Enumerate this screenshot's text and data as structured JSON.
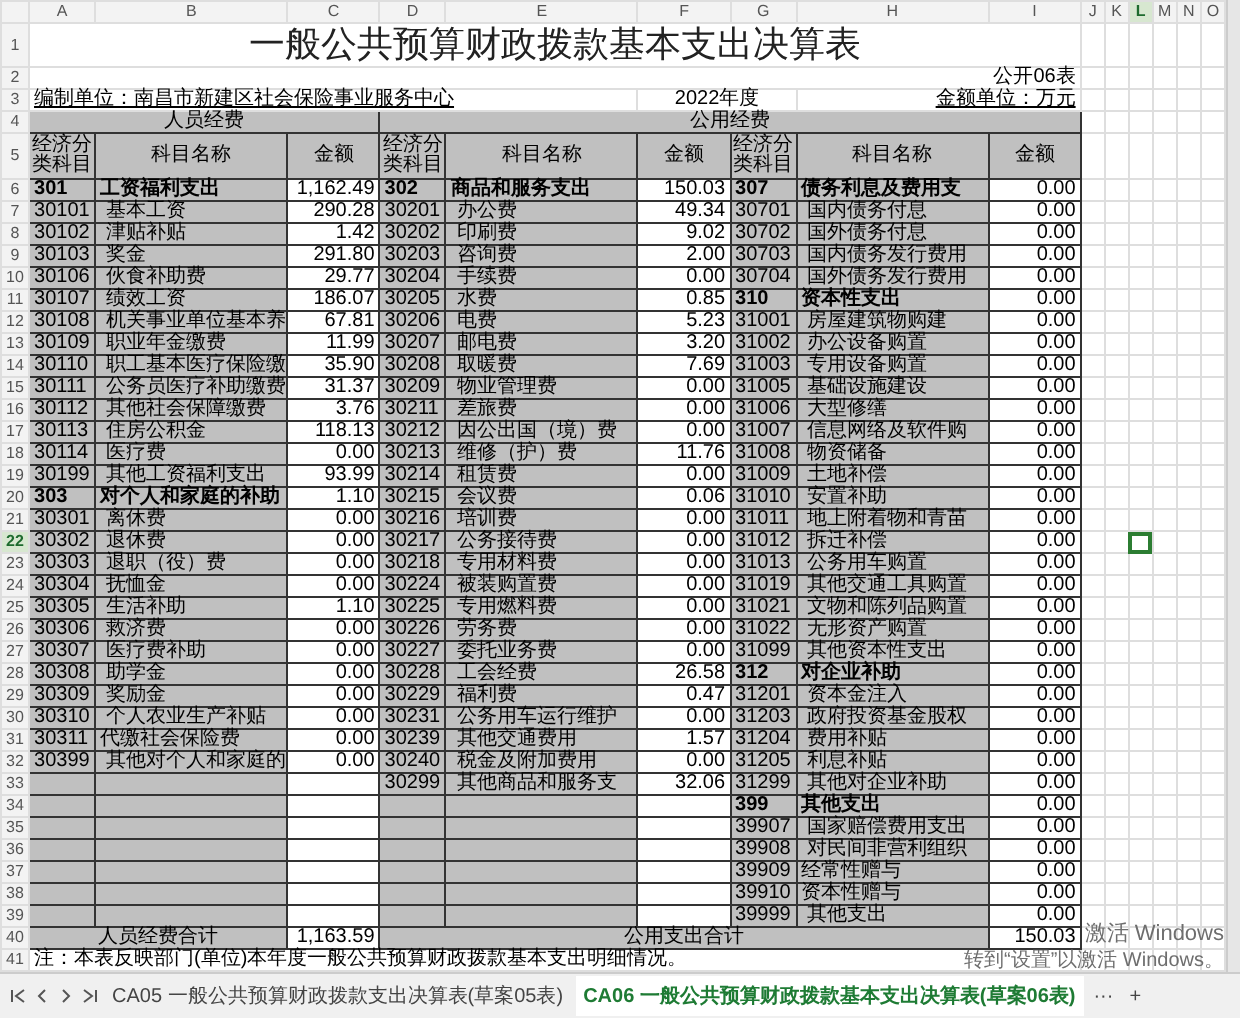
{
  "column_headers": [
    {
      "letter": "A",
      "selected": false
    },
    {
      "letter": "B",
      "selected": false
    },
    {
      "letter": "C",
      "selected": false
    },
    {
      "letter": "D",
      "selected": false
    },
    {
      "letter": "E",
      "selected": false
    },
    {
      "letter": "F",
      "selected": false
    },
    {
      "letter": "G",
      "selected": false
    },
    {
      "letter": "H",
      "selected": false
    },
    {
      "letter": "I",
      "selected": false
    },
    {
      "letter": "J",
      "selected": false
    },
    {
      "letter": "K",
      "selected": false
    },
    {
      "letter": "L",
      "selected": true
    },
    {
      "letter": "M",
      "selected": false
    },
    {
      "letter": "N",
      "selected": false
    },
    {
      "letter": "O",
      "selected": false
    }
  ],
  "row_headers": [
    {
      "label": "1",
      "selected": false
    },
    {
      "label": "2",
      "selected": false
    },
    {
      "label": "3",
      "selected": false
    },
    {
      "label": "4",
      "selected": false
    },
    {
      "label": "5",
      "selected": false
    },
    {
      "label": "6",
      "selected": false
    },
    {
      "label": "7",
      "selected": false
    },
    {
      "label": "8",
      "selected": false
    },
    {
      "label": "9",
      "selected": false
    },
    {
      "label": "10",
      "selected": false
    },
    {
      "label": "11",
      "selected": false
    },
    {
      "label": "12",
      "selected": false
    },
    {
      "label": "13",
      "selected": false
    },
    {
      "label": "14",
      "selected": false
    },
    {
      "label": "15",
      "selected": false
    },
    {
      "label": "16",
      "selected": false
    },
    {
      "label": "17",
      "selected": false
    },
    {
      "label": "18",
      "selected": false
    },
    {
      "label": "19",
      "selected": false
    },
    {
      "label": "20",
      "selected": false
    },
    {
      "label": "21",
      "selected": false
    },
    {
      "label": "22",
      "selected": true
    },
    {
      "label": "23",
      "selected": false
    },
    {
      "label": "24",
      "selected": false
    },
    {
      "label": "25",
      "selected": false
    },
    {
      "label": "26",
      "selected": false
    },
    {
      "label": "27",
      "selected": false
    },
    {
      "label": "28",
      "selected": false
    },
    {
      "label": "29",
      "selected": false
    },
    {
      "label": "30",
      "selected": false
    },
    {
      "label": "31",
      "selected": false
    },
    {
      "label": "32",
      "selected": false
    },
    {
      "label": "33",
      "selected": false
    },
    {
      "label": "34",
      "selected": false
    },
    {
      "label": "35",
      "selected": false
    },
    {
      "label": "36",
      "selected": false
    },
    {
      "label": "37",
      "selected": false
    },
    {
      "label": "38",
      "selected": false
    },
    {
      "label": "39",
      "selected": false
    },
    {
      "label": "40",
      "selected": false
    },
    {
      "label": "41",
      "selected": false
    }
  ],
  "report": {
    "title": "一般公共预算财政拨款基本支出决算表",
    "table_no": "公开06表",
    "unit": "编制单位：南昌市新建区社会保险事业服务中心",
    "year": "2022年度",
    "money_unit": "金额单位：万元",
    "section_left": "人员经费",
    "section_right": "公用经费",
    "headings": [
      "经济分类科目",
      "科目名称",
      "金额",
      "经济分类科目",
      "科目名称",
      "金额",
      "经济分类科目",
      "科目名称",
      "金额"
    ],
    "body": [
      {
        "groups": [
          {
            "kind": "category",
            "code": "301",
            "name": "工资福利支出",
            "amount": "1,162.49"
          },
          {
            "kind": "category",
            "code": "302",
            "name": "商品和服务支出",
            "amount": "150.03"
          },
          {
            "kind": "category",
            "code": "307",
            "name": "债务利息及费用支",
            "amount": "0.00"
          }
        ]
      },
      {
        "groups": [
          {
            "kind": "item",
            "code": "30101",
            "name": "基本工资",
            "amount": "290.28"
          },
          {
            "kind": "item",
            "code": "30201",
            "name": "办公费",
            "amount": "49.34"
          },
          {
            "kind": "item",
            "code": "30701",
            "name": "国内债务付息",
            "amount": "0.00"
          }
        ]
      },
      {
        "groups": [
          {
            "kind": "item",
            "code": "30102",
            "name": "津贴补贴",
            "amount": "1.42"
          },
          {
            "kind": "item",
            "code": "30202",
            "name": "印刷费",
            "amount": "9.02"
          },
          {
            "kind": "item",
            "code": "30702",
            "name": "国外债务付息",
            "amount": "0.00"
          }
        ]
      },
      {
        "groups": [
          {
            "kind": "item",
            "code": "30103",
            "name": "奖金",
            "amount": "291.80"
          },
          {
            "kind": "item",
            "code": "30203",
            "name": "咨询费",
            "amount": "2.00"
          },
          {
            "kind": "item",
            "code": "30703",
            "name": "国内债务发行费用",
            "amount": "0.00"
          }
        ]
      },
      {
        "groups": [
          {
            "kind": "item",
            "code": "30106",
            "name": "伙食补助费",
            "amount": "29.77"
          },
          {
            "kind": "item",
            "code": "30204",
            "name": "手续费",
            "amount": "0.00"
          },
          {
            "kind": "item",
            "code": "30704",
            "name": "国外债务发行费用",
            "amount": "0.00"
          }
        ]
      },
      {
        "groups": [
          {
            "kind": "item",
            "code": "30107",
            "name": "绩效工资",
            "amount": "186.07"
          },
          {
            "kind": "item",
            "code": "30205",
            "name": "水费",
            "amount": "0.85"
          },
          {
            "kind": "category",
            "code": "310",
            "name": "资本性支出",
            "amount": "0.00"
          }
        ]
      },
      {
        "groups": [
          {
            "kind": "item",
            "code": "30108",
            "name": "机关事业单位基本养",
            "amount": "67.81"
          },
          {
            "kind": "item",
            "code": "30206",
            "name": "电费",
            "amount": "5.23"
          },
          {
            "kind": "item",
            "code": "31001",
            "name": "房屋建筑物购建",
            "amount": "0.00"
          }
        ]
      },
      {
        "groups": [
          {
            "kind": "item",
            "code": "30109",
            "name": "职业年金缴费",
            "amount": "11.99"
          },
          {
            "kind": "item",
            "code": "30207",
            "name": "邮电费",
            "amount": "3.20"
          },
          {
            "kind": "item",
            "code": "31002",
            "name": "办公设备购置",
            "amount": "0.00"
          }
        ]
      },
      {
        "groups": [
          {
            "kind": "item",
            "code": "30110",
            "name": "职工基本医疗保险缴",
            "amount": "35.90"
          },
          {
            "kind": "item",
            "code": "30208",
            "name": "取暖费",
            "amount": "7.69"
          },
          {
            "kind": "item",
            "code": "31003",
            "name": "专用设备购置",
            "amount": "0.00"
          }
        ]
      },
      {
        "groups": [
          {
            "kind": "item",
            "code": "30111",
            "name": "公务员医疗补助缴费",
            "amount": "31.37"
          },
          {
            "kind": "item",
            "code": "30209",
            "name": "物业管理费",
            "amount": "0.00"
          },
          {
            "kind": "item",
            "code": "31005",
            "name": "基础设施建设",
            "amount": "0.00"
          }
        ]
      },
      {
        "groups": [
          {
            "kind": "item",
            "code": "30112",
            "name": "其他社会保障缴费",
            "amount": "3.76"
          },
          {
            "kind": "item",
            "code": "30211",
            "name": "差旅费",
            "amount": "0.00"
          },
          {
            "kind": "item",
            "code": "31006",
            "name": "大型修缮",
            "amount": "0.00"
          }
        ]
      },
      {
        "groups": [
          {
            "kind": "item",
            "code": "30113",
            "name": "住房公积金",
            "amount": "118.13"
          },
          {
            "kind": "item",
            "code": "30212",
            "name": "因公出国（境）费",
            "amount": "0.00"
          },
          {
            "kind": "item",
            "code": "31007",
            "name": "信息网络及软件购",
            "amount": "0.00"
          }
        ]
      },
      {
        "groups": [
          {
            "kind": "item",
            "code": "30114",
            "name": "医疗费",
            "amount": "0.00"
          },
          {
            "kind": "item",
            "code": "30213",
            "name": "维修（护）费",
            "amount": "11.76"
          },
          {
            "kind": "item",
            "code": "31008",
            "name": "物资储备",
            "amount": "0.00"
          }
        ]
      },
      {
        "groups": [
          {
            "kind": "item",
            "code": "30199",
            "name": "其他工资福利支出",
            "amount": "93.99"
          },
          {
            "kind": "item",
            "code": "30214",
            "name": "租赁费",
            "amount": "0.00"
          },
          {
            "kind": "item",
            "code": "31009",
            "name": "土地补偿",
            "amount": "0.00"
          }
        ]
      },
      {
        "groups": [
          {
            "kind": "category",
            "code": "303",
            "name": "对个人和家庭的补助",
            "amount": "1.10"
          },
          {
            "kind": "item",
            "code": "30215",
            "name": "会议费",
            "amount": "0.06"
          },
          {
            "kind": "item",
            "code": "31010",
            "name": "安置补助",
            "amount": "0.00"
          }
        ]
      },
      {
        "groups": [
          {
            "kind": "item",
            "code": "30301",
            "name": "离休费",
            "amount": "0.00"
          },
          {
            "kind": "item",
            "code": "30216",
            "name": "培训费",
            "amount": "0.00"
          },
          {
            "kind": "item",
            "code": "31011",
            "name": "地上附着物和青苗",
            "amount": "0.00"
          }
        ]
      },
      {
        "groups": [
          {
            "kind": "item",
            "code": "30302",
            "name": "退休费",
            "amount": "0.00"
          },
          {
            "kind": "item",
            "code": "30217",
            "name": "公务接待费",
            "amount": "0.00"
          },
          {
            "kind": "item",
            "code": "31012",
            "name": "拆迁补偿",
            "amount": "0.00"
          }
        ]
      },
      {
        "groups": [
          {
            "kind": "item",
            "code": "30303",
            "name": "退职（役）费",
            "amount": "0.00"
          },
          {
            "kind": "item",
            "code": "30218",
            "name": "专用材料费",
            "amount": "0.00"
          },
          {
            "kind": "item",
            "code": "31013",
            "name": "公务用车购置",
            "amount": "0.00"
          }
        ]
      },
      {
        "groups": [
          {
            "kind": "item",
            "code": "30304",
            "name": "抚恤金",
            "amount": "0.00"
          },
          {
            "kind": "item",
            "code": "30224",
            "name": "被装购置费",
            "amount": "0.00"
          },
          {
            "kind": "item",
            "code": "31019",
            "name": "其他交通工具购置",
            "amount": "0.00"
          }
        ]
      },
      {
        "groups": [
          {
            "kind": "item",
            "code": "30305",
            "name": "生活补助",
            "amount": "1.10"
          },
          {
            "kind": "item",
            "code": "30225",
            "name": "专用燃料费",
            "amount": "0.00"
          },
          {
            "kind": "item",
            "code": "31021",
            "name": "文物和陈列品购置",
            "amount": "0.00"
          }
        ]
      },
      {
        "groups": [
          {
            "kind": "item",
            "code": "30306",
            "name": "救济费",
            "amount": "0.00"
          },
          {
            "kind": "item",
            "code": "30226",
            "name": "劳务费",
            "amount": "0.00"
          },
          {
            "kind": "item",
            "code": "31022",
            "name": "无形资产购置",
            "amount": "0.00"
          }
        ]
      },
      {
        "groups": [
          {
            "kind": "item",
            "code": "30307",
            "name": "医疗费补助",
            "amount": "0.00"
          },
          {
            "kind": "item",
            "code": "30227",
            "name": "委托业务费",
            "amount": "0.00"
          },
          {
            "kind": "item",
            "code": "31099",
            "name": "其他资本性支出",
            "amount": "0.00"
          }
        ]
      },
      {
        "groups": [
          {
            "kind": "item",
            "code": "30308",
            "name": "助学金",
            "amount": "0.00"
          },
          {
            "kind": "item",
            "code": "30228",
            "name": "工会经费",
            "amount": "26.58"
          },
          {
            "kind": "category",
            "code": "312",
            "name": "对企业补助",
            "amount": "0.00"
          }
        ]
      },
      {
        "groups": [
          {
            "kind": "item",
            "code": "30309",
            "name": "奖励金",
            "amount": "0.00"
          },
          {
            "kind": "item",
            "code": "30229",
            "name": "福利费",
            "amount": "0.47"
          },
          {
            "kind": "item",
            "code": "31201",
            "name": "资本金注入",
            "amount": "0.00"
          }
        ]
      },
      {
        "groups": [
          {
            "kind": "item",
            "code": "30310",
            "name": "个人农业生产补贴",
            "amount": "0.00"
          },
          {
            "kind": "item",
            "code": "30231",
            "name": "公务用车运行维护",
            "amount": "0.00"
          },
          {
            "kind": "item",
            "code": "31203",
            "name": "政府投资基金股权",
            "amount": "0.00"
          }
        ]
      },
      {
        "groups": [
          {
            "kind": "plain",
            "code": "30311",
            "name": "代缴社会保险费",
            "amount": "0.00"
          },
          {
            "kind": "item",
            "code": "30239",
            "name": "其他交通费用",
            "amount": "1.57"
          },
          {
            "kind": "item",
            "code": "31204",
            "name": "费用补贴",
            "amount": "0.00"
          }
        ]
      },
      {
        "groups": [
          {
            "kind": "item",
            "code": "30399",
            "name": "其他对个人和家庭的",
            "amount": "0.00"
          },
          {
            "kind": "item",
            "code": "30240",
            "name": "税金及附加费用",
            "amount": "0.00"
          },
          {
            "kind": "item",
            "code": "31205",
            "name": "利息补贴",
            "amount": "0.00"
          }
        ]
      },
      {
        "groups": [
          {
            "kind": "blank"
          },
          {
            "kind": "item",
            "code": "30299",
            "name": "其他商品和服务支",
            "amount": "32.06"
          },
          {
            "kind": "item",
            "code": "31299",
            "name": "其他对企业补助",
            "amount": "0.00"
          }
        ]
      },
      {
        "groups": [
          {
            "kind": "blank"
          },
          {
            "kind": "blank"
          },
          {
            "kind": "category",
            "code": "399",
            "name": "其他支出",
            "amount": "0.00"
          }
        ]
      },
      {
        "groups": [
          {
            "kind": "blank"
          },
          {
            "kind": "blank"
          },
          {
            "kind": "item",
            "code": "39907",
            "name": "国家赔偿费用支出",
            "amount": "0.00"
          }
        ]
      },
      {
        "groups": [
          {
            "kind": "blank"
          },
          {
            "kind": "blank"
          },
          {
            "kind": "item",
            "code": "39908",
            "name": "对民间非营利组织",
            "amount": "0.00"
          }
        ]
      },
      {
        "groups": [
          {
            "kind": "blank"
          },
          {
            "kind": "blank"
          },
          {
            "kind": "plain",
            "code": "39909",
            "name": "经常性赠与",
            "amount": "0.00"
          }
        ]
      },
      {
        "groups": [
          {
            "kind": "blank"
          },
          {
            "kind": "blank"
          },
          {
            "kind": "plain",
            "code": "39910",
            "name": "资本性赠与",
            "amount": "0.00"
          }
        ]
      },
      {
        "groups": [
          {
            "kind": "blank"
          },
          {
            "kind": "blank"
          },
          {
            "kind": "item",
            "code": "39999",
            "name": "其他支出",
            "amount": "0.00"
          }
        ]
      }
    ],
    "totals": {
      "left_label": "人员经费合计",
      "left_amount": "1,163.59",
      "right_label": "公用支出合计",
      "right_amount": "150.03"
    },
    "note": "注：本表反映部门(单位)本年度一般公共预算财政拨款基本支出明细情况。"
  },
  "sheet_tabs": [
    {
      "label": "CA05 一般公共预算财政拨款支出决算表(草案05表)",
      "selected": false
    },
    {
      "label": "CA06 一般公共预算财政拨款基本支出决算表(草案06表)",
      "selected": true
    }
  ],
  "more_tabs": "···",
  "add_tab": "+",
  "activation": {
    "title": "激活 Windows",
    "hint": "转到“设置”以激活 Windows。"
  }
}
